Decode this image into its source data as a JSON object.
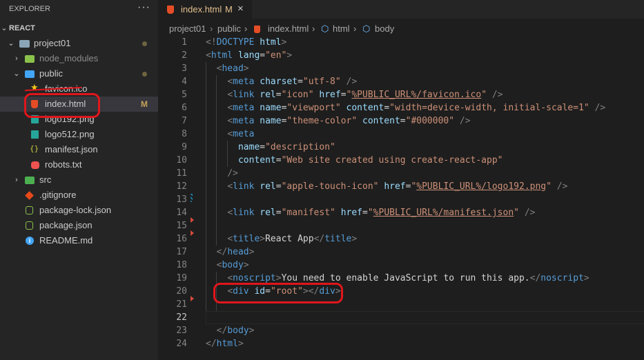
{
  "sidebar": {
    "title": "EXPLORER",
    "more_icon": "···",
    "root": "REACT",
    "items": [
      {
        "label": "project01",
        "icon": "folder-open",
        "modified": true
      },
      {
        "label": "node_modules",
        "icon": "folder-node-modules"
      },
      {
        "label": "public",
        "icon": "folder-public",
        "modified": true
      },
      {
        "label": "favicon.ico",
        "icon": "star-icon"
      },
      {
        "label": "index.html",
        "icon": "html5-icon",
        "badge": "M",
        "selected": true
      },
      {
        "label": "logo192.png",
        "icon": "image-icon"
      },
      {
        "label": "logo512.png",
        "icon": "image-icon"
      },
      {
        "label": "manifest.json",
        "icon": "json-braces-icon"
      },
      {
        "label": "robots.txt",
        "icon": "robot-icon"
      },
      {
        "label": "src",
        "icon": "folder-src"
      },
      {
        "label": ".gitignore",
        "icon": "git-icon"
      },
      {
        "label": "package-lock.json",
        "icon": "nodejs-icon"
      },
      {
        "label": "package.json",
        "icon": "nodejs-icon"
      },
      {
        "label": "README.md",
        "icon": "info-icon"
      }
    ]
  },
  "tab": {
    "label": "index.html",
    "badge": "M",
    "close": "×"
  },
  "breadcrumbs": {
    "project": "project01",
    "folder": "public",
    "file": "index.html",
    "html": "html",
    "body": "body"
  },
  "editor": {
    "active_line": "22",
    "line_numbers": [
      "1",
      "2",
      "3",
      "4",
      "5",
      "6",
      "7",
      "8",
      "9",
      "10",
      "11",
      "12",
      "13",
      "14",
      "15",
      "16",
      "17",
      "18",
      "19",
      "20",
      "21",
      "22",
      "23",
      "24"
    ],
    "lines": [
      [
        [
          "punc",
          "<!"
        ],
        [
          "tag",
          "DOCTYPE"
        ],
        [
          "txt",
          " "
        ],
        [
          "attr",
          "html"
        ],
        [
          "punc",
          ">"
        ]
      ],
      [
        [
          "punc",
          "<"
        ],
        [
          "tag",
          "html"
        ],
        [
          "txt",
          " "
        ],
        [
          "attr",
          "lang"
        ],
        [
          "txt",
          "="
        ],
        [
          "str",
          "\"en\""
        ],
        [
          "punc",
          ">"
        ]
      ],
      [
        [
          "txt",
          "  "
        ],
        [
          "punc",
          "<"
        ],
        [
          "tag",
          "head"
        ],
        [
          "punc",
          ">"
        ]
      ],
      [
        [
          "txt",
          "    "
        ],
        [
          "punc",
          "<"
        ],
        [
          "tag",
          "meta"
        ],
        [
          "txt",
          " "
        ],
        [
          "attr",
          "charset"
        ],
        [
          "txt",
          "="
        ],
        [
          "str",
          "\"utf-8\""
        ],
        [
          "txt",
          " "
        ],
        [
          "punc",
          "/>"
        ]
      ],
      [
        [
          "txt",
          "    "
        ],
        [
          "punc",
          "<"
        ],
        [
          "tag",
          "link"
        ],
        [
          "txt",
          " "
        ],
        [
          "attr",
          "rel"
        ],
        [
          "txt",
          "="
        ],
        [
          "str",
          "\"icon\""
        ],
        [
          "txt",
          " "
        ],
        [
          "attr",
          "href"
        ],
        [
          "txt",
          "="
        ],
        [
          "str",
          "\""
        ],
        [
          "stru",
          "%PUBLIC_URL%/favicon.ico"
        ],
        [
          "str",
          "\""
        ],
        [
          "txt",
          " "
        ],
        [
          "punc",
          "/>"
        ]
      ],
      [
        [
          "txt",
          "    "
        ],
        [
          "punc",
          "<"
        ],
        [
          "tag",
          "meta"
        ],
        [
          "txt",
          " "
        ],
        [
          "attr",
          "name"
        ],
        [
          "txt",
          "="
        ],
        [
          "str",
          "\"viewport\""
        ],
        [
          "txt",
          " "
        ],
        [
          "attr",
          "content"
        ],
        [
          "txt",
          "="
        ],
        [
          "str",
          "\"width=device-width, initial-scale=1\""
        ],
        [
          "txt",
          " "
        ],
        [
          "punc",
          "/>"
        ]
      ],
      [
        [
          "txt",
          "    "
        ],
        [
          "punc",
          "<"
        ],
        [
          "tag",
          "meta"
        ],
        [
          "txt",
          " "
        ],
        [
          "attr",
          "name"
        ],
        [
          "txt",
          "="
        ],
        [
          "str",
          "\"theme-color\""
        ],
        [
          "txt",
          " "
        ],
        [
          "attr",
          "content"
        ],
        [
          "txt",
          "="
        ],
        [
          "str",
          "\"#000000\""
        ],
        [
          "txt",
          " "
        ],
        [
          "punc",
          "/>"
        ]
      ],
      [
        [
          "txt",
          "    "
        ],
        [
          "punc",
          "<"
        ],
        [
          "tag",
          "meta"
        ]
      ],
      [
        [
          "txt",
          "      "
        ],
        [
          "attr",
          "name"
        ],
        [
          "txt",
          "="
        ],
        [
          "str",
          "\"description\""
        ]
      ],
      [
        [
          "txt",
          "      "
        ],
        [
          "attr",
          "content"
        ],
        [
          "txt",
          "="
        ],
        [
          "str",
          "\"Web site created using create-react-app\""
        ]
      ],
      [
        [
          "txt",
          "    "
        ],
        [
          "punc",
          "/>"
        ]
      ],
      [
        [
          "txt",
          "    "
        ],
        [
          "punc",
          "<"
        ],
        [
          "tag",
          "link"
        ],
        [
          "txt",
          " "
        ],
        [
          "attr",
          "rel"
        ],
        [
          "txt",
          "="
        ],
        [
          "str",
          "\"apple-touch-icon\""
        ],
        [
          "txt",
          " "
        ],
        [
          "attr",
          "href"
        ],
        [
          "txt",
          "="
        ],
        [
          "str",
          "\""
        ],
        [
          "stru",
          "%PUBLIC_URL%/logo192.png"
        ],
        [
          "str",
          "\""
        ],
        [
          "txt",
          " "
        ],
        [
          "punc",
          "/>"
        ]
      ],
      [],
      [
        [
          "txt",
          "    "
        ],
        [
          "punc",
          "<"
        ],
        [
          "tag",
          "link"
        ],
        [
          "txt",
          " "
        ],
        [
          "attr",
          "rel"
        ],
        [
          "txt",
          "="
        ],
        [
          "str",
          "\"manifest\""
        ],
        [
          "txt",
          " "
        ],
        [
          "attr",
          "href"
        ],
        [
          "txt",
          "="
        ],
        [
          "str",
          "\""
        ],
        [
          "stru",
          "%PUBLIC_URL%/manifest.json"
        ],
        [
          "str",
          "\""
        ],
        [
          "txt",
          " "
        ],
        [
          "punc",
          "/>"
        ]
      ],
      [],
      [
        [
          "txt",
          "    "
        ],
        [
          "punc",
          "<"
        ],
        [
          "tag",
          "title"
        ],
        [
          "punc",
          ">"
        ],
        [
          "txt",
          "React App"
        ],
        [
          "punc",
          "</"
        ],
        [
          "tag",
          "title"
        ],
        [
          "punc",
          ">"
        ]
      ],
      [
        [
          "txt",
          "  "
        ],
        [
          "punc",
          "</"
        ],
        [
          "tag",
          "head"
        ],
        [
          "punc",
          ">"
        ]
      ],
      [
        [
          "txt",
          "  "
        ],
        [
          "punc",
          "<"
        ],
        [
          "tag",
          "body"
        ],
        [
          "punc",
          ">"
        ]
      ],
      [
        [
          "txt",
          "    "
        ],
        [
          "punc",
          "<"
        ],
        [
          "tag",
          "noscript"
        ],
        [
          "punc",
          ">"
        ],
        [
          "txt",
          "You need to enable JavaScript to run this app."
        ],
        [
          "punc",
          "</"
        ],
        [
          "tag",
          "noscript"
        ],
        [
          "punc",
          ">"
        ]
      ],
      [
        [
          "txt",
          "    "
        ],
        [
          "punc",
          "<"
        ],
        [
          "tag",
          "div"
        ],
        [
          "txt",
          " "
        ],
        [
          "attr",
          "id"
        ],
        [
          "txt",
          "="
        ],
        [
          "str",
          "\"root\""
        ],
        [
          "punc",
          ">"
        ],
        [
          "punc",
          "</"
        ],
        [
          "tag",
          "div"
        ],
        [
          "punc",
          ">"
        ]
      ],
      [],
      [],
      [
        [
          "txt",
          "  "
        ],
        [
          "punc",
          "</"
        ],
        [
          "tag",
          "body"
        ],
        [
          "punc",
          ">"
        ]
      ],
      [
        [
          "punc",
          "</"
        ],
        [
          "tag",
          "html"
        ],
        [
          "punc",
          ">"
        ]
      ]
    ]
  },
  "colors": {
    "editor_bg": "#1e1e1e",
    "sidebar_bg": "#252526",
    "annotation_red": "#e0161b",
    "modified": "#e2c08d"
  }
}
